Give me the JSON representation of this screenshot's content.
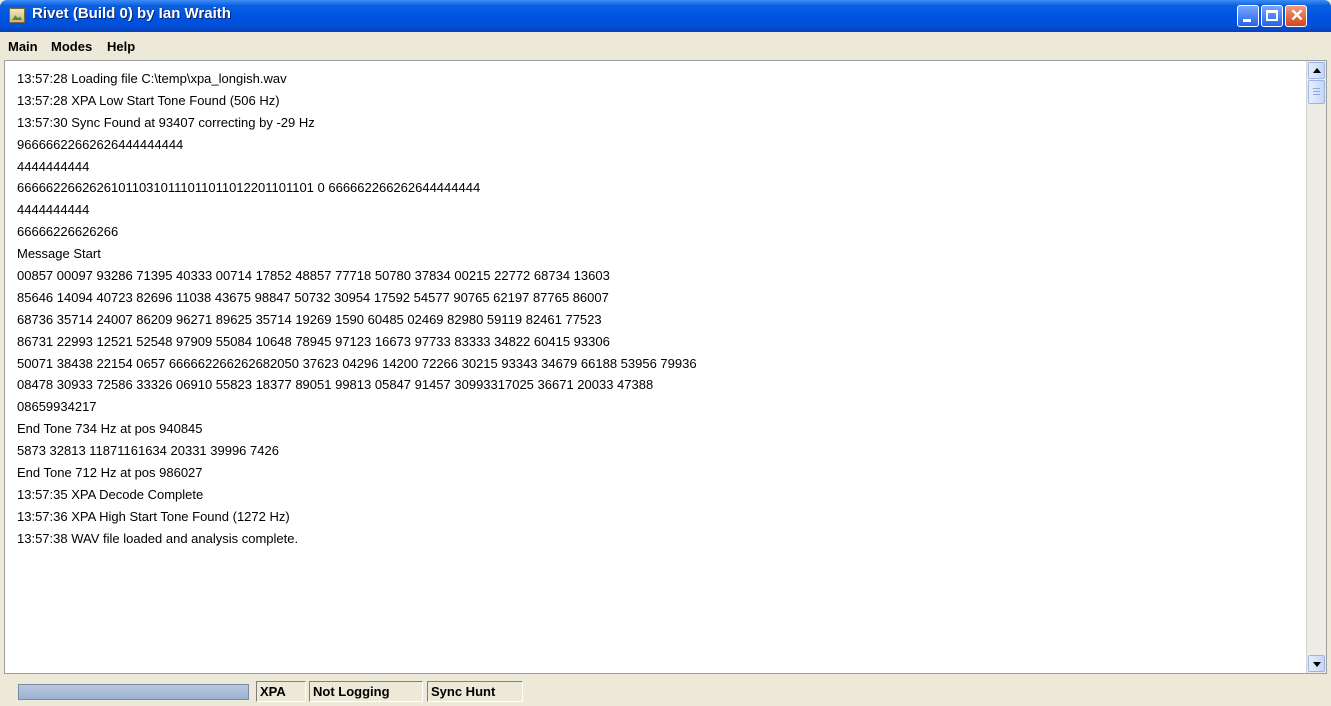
{
  "window": {
    "title": "Rivet (Build 0) by Ian Wraith"
  },
  "menubar": {
    "items": [
      "Main",
      "Modes",
      "Help"
    ]
  },
  "log": {
    "lines": [
      "13:57:28 Loading file C:\\temp\\xpa_longish.wav",
      "13:57:28 XPA Low Start Tone Found (506 Hz)",
      "13:57:30 Sync Found at 93407 correcting by -29 Hz",
      "96666622662626444444444",
      "4444444444",
      "666662266262610110310111011011012201101101 0 666662266262644444444",
      "4444444444",
      "66666226626266",
      "Message Start",
      "00857 00097 93286 71395 40333 00714 17852 48857 77718 50780 37834 00215 22772 68734 13603",
      "85646 14094 40723 82696 11038 43675 98847 50732 30954 17592 54577 90765 62197 87765 86007",
      "68736 35714 24007 86209 96271 89625 35714 19269 1590 60485 02469 82980 59119 82461 77523",
      "86731 22993 12521 52548 97909 55084 10648 78945 97123 16673 97733 83333 34822 60415 93306",
      "50071 38438 22154 0657 666662266262682050 37623 04296 14200 72266 30215 93343 34679 66188 53956 79936",
      "08478 30933 72586 33326 06910 55823 18377 89051 99813 05847 91457 30993317025 36671 20033 47388",
      "08659934217",
      "End Tone 734 Hz at pos 940845",
      "5873 32813 11871161634 20331 39996 7426",
      "End Tone 712 Hz at pos 986027",
      "13:57:35 XPA Decode Complete",
      "13:57:36 XPA High Start Tone Found (1272 Hz)",
      "13:57:38 WAV file loaded and analysis complete."
    ]
  },
  "statusbar": {
    "progress_fraction": 1.0,
    "mode": "XPA",
    "logging": "Not Logging",
    "sync": "Sync Hunt"
  },
  "icons": {
    "app": "app-image-icon",
    "minimize": "minimize-icon",
    "maximize": "maximize-icon",
    "close": "close-icon"
  },
  "colors": {
    "titlebar": "#0054e3",
    "window_bg": "#ece9d8",
    "close_button": "#d2451f"
  }
}
